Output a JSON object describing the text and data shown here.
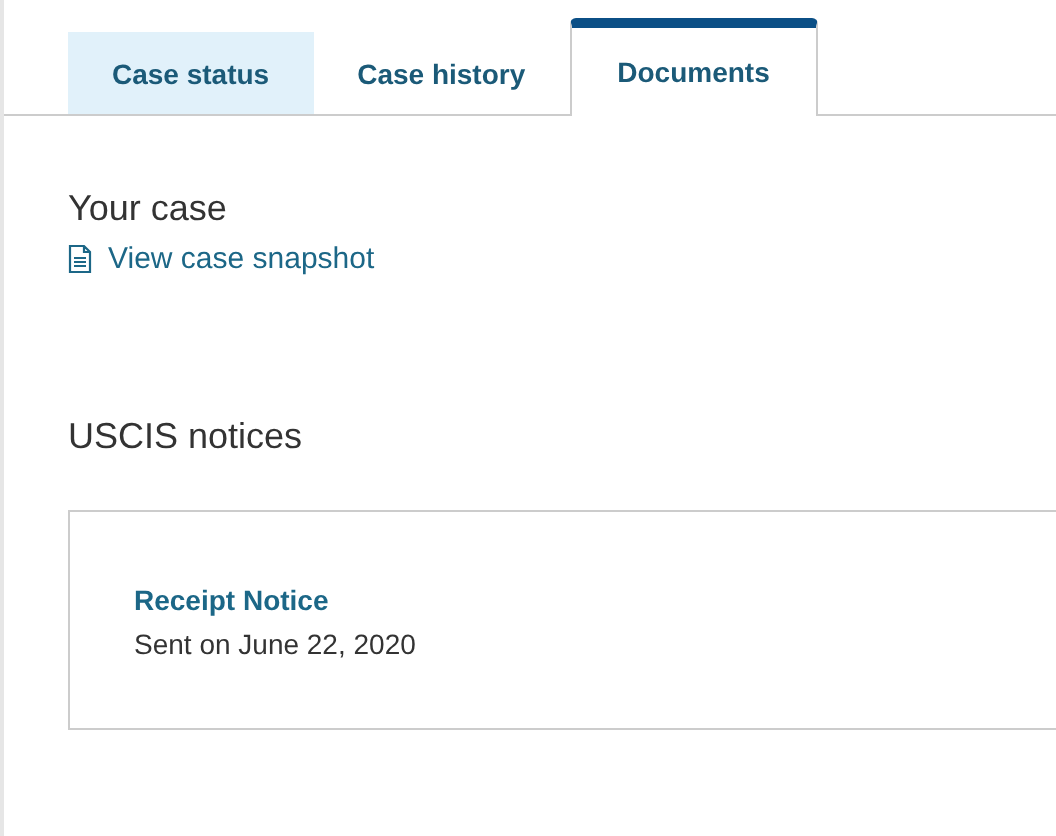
{
  "tabs": [
    {
      "label": "Case status",
      "selected": false,
      "highlighted": true
    },
    {
      "label": "Case history",
      "selected": false,
      "highlighted": false
    },
    {
      "label": "Documents",
      "selected": true,
      "highlighted": false
    }
  ],
  "your_case": {
    "heading": "Your case",
    "link": "View case snapshot"
  },
  "notices": {
    "heading": "USCIS notices",
    "items": [
      {
        "title": "Receipt Notice",
        "date": "Sent on June 22, 2020"
      }
    ]
  }
}
